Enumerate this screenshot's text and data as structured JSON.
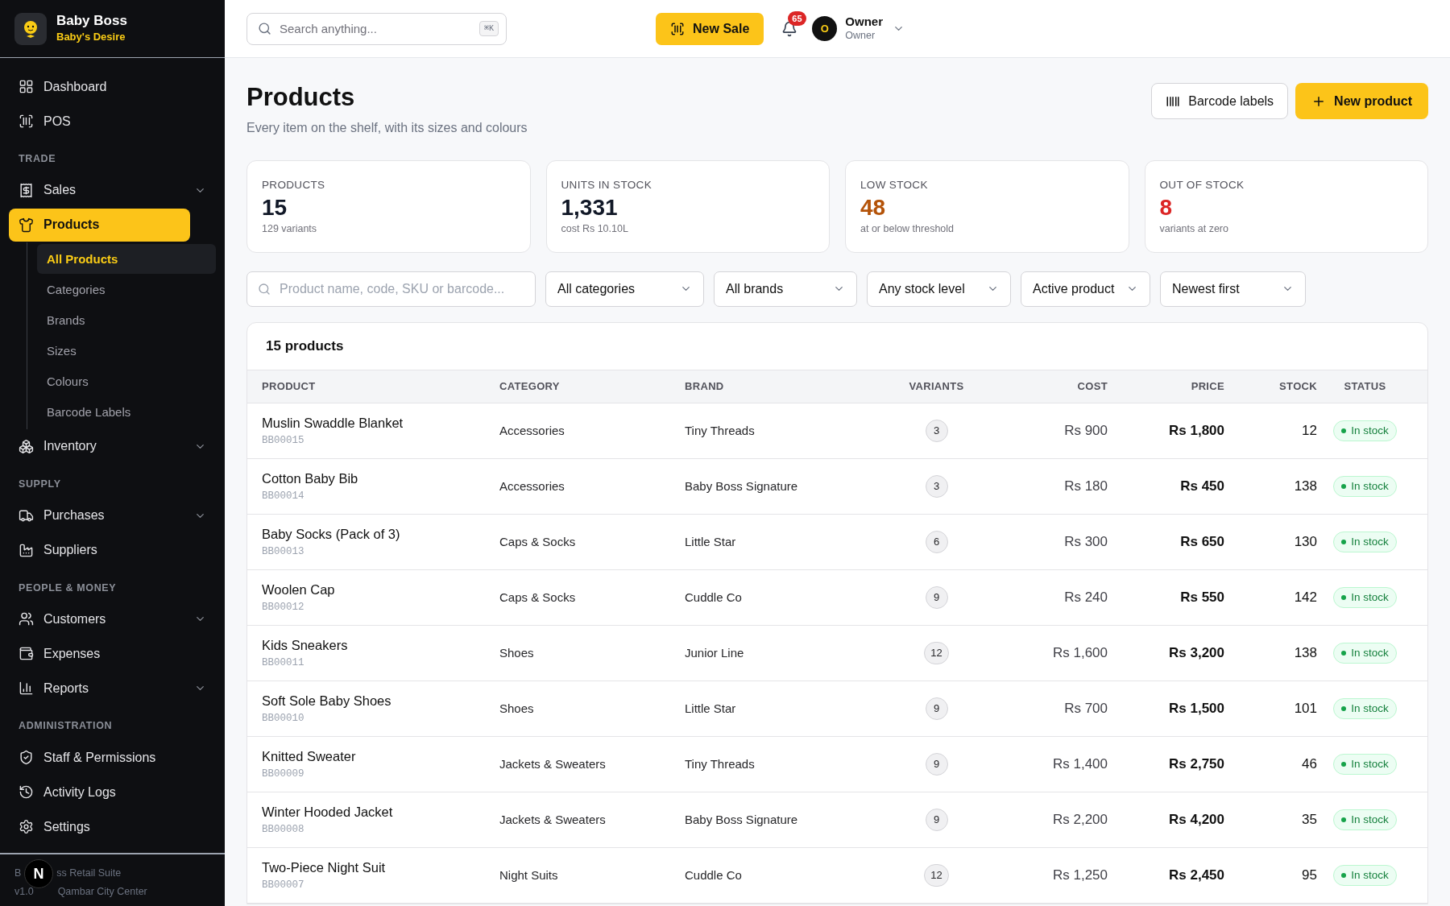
{
  "brand": {
    "name": "Baby Boss",
    "tagline": "Baby's Desire"
  },
  "sidebar": {
    "sections": [
      {
        "items": [
          {
            "label": "Dashboard",
            "kind": "link",
            "selected": false
          },
          {
            "label": "POS",
            "kind": "link",
            "selected": false
          }
        ]
      },
      {
        "heading": "TRADE",
        "items": [
          {
            "label": "Sales",
            "kind": "group",
            "expanded": false,
            "selected": false
          },
          {
            "label": "Products",
            "kind": "group",
            "expanded": true,
            "selected": true,
            "children": [
              {
                "label": "All Products",
                "selected": true
              },
              {
                "label": "Categories",
                "selected": false
              },
              {
                "label": "Brands",
                "selected": false
              },
              {
                "label": "Sizes",
                "selected": false
              },
              {
                "label": "Colours",
                "selected": false
              },
              {
                "label": "Barcode Labels",
                "selected": false
              }
            ]
          },
          {
            "label": "Inventory",
            "kind": "group",
            "expanded": false,
            "selected": false
          }
        ]
      },
      {
        "heading": "SUPPLY",
        "items": [
          {
            "label": "Purchases",
            "kind": "group",
            "expanded": false,
            "selected": false
          },
          {
            "label": "Suppliers",
            "kind": "link",
            "selected": false
          }
        ]
      },
      {
        "heading": "PEOPLE & MONEY",
        "items": [
          {
            "label": "Customers",
            "kind": "group",
            "expanded": false,
            "selected": false
          },
          {
            "label": "Expenses",
            "kind": "link",
            "selected": false
          },
          {
            "label": "Reports",
            "kind": "group",
            "expanded": false,
            "selected": false
          }
        ]
      },
      {
        "heading": "ADMINISTRATION",
        "items": [
          {
            "label": "Staff & Permissions",
            "kind": "link",
            "selected": false
          },
          {
            "label": "Activity Logs",
            "kind": "link",
            "selected": false
          },
          {
            "label": "Settings",
            "kind": "link",
            "selected": false
          }
        ]
      }
    ],
    "footer": {
      "line_1_start": "B",
      "line_1_end": "ss Retail Suite",
      "line_2_start": "v1.0",
      "line_2_end": "Qambar City Center",
      "overlay_badge": "N"
    }
  },
  "header": {
    "search": {
      "placeholder": "Search anything...",
      "shortcut": "⌘K"
    },
    "new_sale": "New Sale",
    "notifications": "65",
    "user": {
      "initial": "O",
      "name": "Owner",
      "role": "Owner"
    }
  },
  "page": {
    "title": "Products",
    "subtitle": "Every item on the shelf, with its sizes and colours",
    "actions": [
      "Barcode labels",
      "New product"
    ]
  },
  "stats": [
    {
      "label": "PRODUCTS",
      "value": "15",
      "note": "129 variants",
      "color": "#111827"
    },
    {
      "label": "UNITS IN STOCK",
      "value": "1,331",
      "note": "cost Rs 10.10L",
      "color": "#111827"
    },
    {
      "label": "LOW STOCK",
      "value": "48",
      "note": "at or below threshold",
      "color": "#b45309"
    },
    {
      "label": "OUT OF STOCK",
      "value": "8",
      "note": "variants at zero",
      "color": "#dc2626"
    }
  ],
  "filters": {
    "search": {
      "placeholder": "Product name, code, SKU or barcode..."
    },
    "selects": [
      "All categories",
      "All brands",
      "Any stock level",
      "Active product",
      "Newest first"
    ]
  },
  "table": {
    "count": "15 products",
    "columns": [
      "PRODUCT",
      "CATEGORY",
      "BRAND",
      "VARIANTS",
      "COST",
      "PRICE",
      "STOCK",
      "STATUS"
    ],
    "rows": [
      {
        "name": "Muslin Swaddle Blanket",
        "code": "BB00015",
        "category": "Accessories",
        "brand": "Tiny Threads",
        "variants": "3",
        "cost": "Rs 900",
        "price": "Rs 1,800",
        "stock": "12",
        "status": "In stock",
        "color": "#16a34a"
      },
      {
        "name": "Cotton Baby Bib",
        "code": "BB00014",
        "category": "Accessories",
        "brand": "Baby Boss Signature",
        "variants": "3",
        "cost": "Rs 180",
        "price": "Rs 450",
        "stock": "138",
        "status": "In stock",
        "color": "#16a34a"
      },
      {
        "name": "Baby Socks (Pack of 3)",
        "code": "BB00013",
        "category": "Caps & Socks",
        "brand": "Little Star",
        "variants": "6",
        "cost": "Rs 300",
        "price": "Rs 650",
        "stock": "130",
        "status": "In stock",
        "color": "#16a34a"
      },
      {
        "name": "Woolen Cap",
        "code": "BB00012",
        "category": "Caps & Socks",
        "brand": "Cuddle Co",
        "variants": "9",
        "cost": "Rs 240",
        "price": "Rs 550",
        "stock": "142",
        "status": "In stock",
        "color": "#16a34a"
      },
      {
        "name": "Kids Sneakers",
        "code": "BB00011",
        "category": "Shoes",
        "brand": "Junior Line",
        "variants": "12",
        "cost": "Rs 1,600",
        "price": "Rs 3,200",
        "stock": "138",
        "status": "In stock",
        "color": "#16a34a"
      },
      {
        "name": "Soft Sole Baby Shoes",
        "code": "BB00010",
        "category": "Shoes",
        "brand": "Little Star",
        "variants": "9",
        "cost": "Rs 700",
        "price": "Rs 1,500",
        "stock": "101",
        "status": "In stock",
        "color": "#16a34a"
      },
      {
        "name": "Knitted Sweater",
        "code": "BB00009",
        "category": "Jackets & Sweaters",
        "brand": "Tiny Threads",
        "variants": "9",
        "cost": "Rs 1,400",
        "price": "Rs 2,750",
        "stock": "46",
        "status": "In stock",
        "color": "#16a34a"
      },
      {
        "name": "Winter Hooded Jacket",
        "code": "BB00008",
        "category": "Jackets & Sweaters",
        "brand": "Baby Boss Signature",
        "variants": "9",
        "cost": "Rs 2,200",
        "price": "Rs 4,200",
        "stock": "35",
        "status": "In stock",
        "color": "#16a34a"
      },
      {
        "name": "Two-Piece Night Suit",
        "code": "BB00007",
        "category": "Night Suits",
        "brand": "Cuddle Co",
        "variants": "12",
        "cost": "Rs 1,250",
        "price": "Rs 2,450",
        "stock": "95",
        "status": "In stock",
        "color": "#16a34a"
      }
    ]
  }
}
